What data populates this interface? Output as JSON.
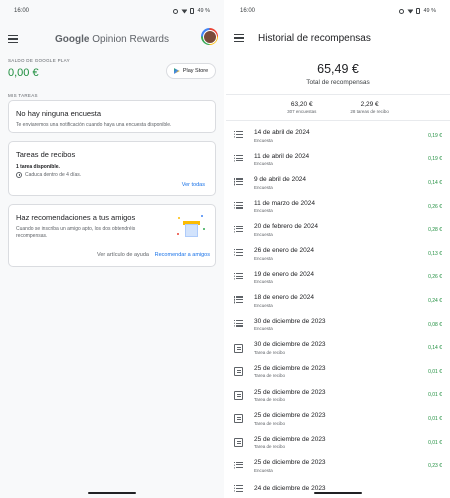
{
  "left": {
    "status": {
      "time": "16:00",
      "battery": "49 %"
    },
    "brand": {
      "google": "Google",
      "rest": "Opinion Rewards"
    },
    "balance_label": "SALDO DE GOOGLE PLAY",
    "balance_value": "0,00 €",
    "play_store_button": "Play Store",
    "tasks_label": "MIS TAREAS",
    "survey_card": {
      "title": "No hay ninguna encuesta",
      "text": "Te enviaremos una notificación cuando haya una encuesta disponible."
    },
    "receipts_card": {
      "title": "Tareas de recibos",
      "available": "1 tarea disponible.",
      "expires": "Caduca dentro de 4 días.",
      "link": "Ver todas"
    },
    "recommend_card": {
      "title": "Haz recomendaciones a tus amigos",
      "text": "Cuando se inscriba un amigo apto, los dos obtendréis recompensas.",
      "help_link": "Ver artículo de ayuda",
      "action_link": "Recomendar a amigos"
    }
  },
  "right": {
    "status": {
      "time": "16:00",
      "battery": "49 %"
    },
    "title": "Historial de recompensas",
    "total_value": "65,49 €",
    "total_label": "Total de recompensas",
    "stats": [
      {
        "value": "63,20 €",
        "label": "307 encuestas"
      },
      {
        "value": "2,29 €",
        "label": "28 tareas de recibo"
      }
    ],
    "entries": [
      {
        "date": "14 de abril de 2024",
        "type": "Encuesta",
        "amount": "0,19 €",
        "icon": "list-icon"
      },
      {
        "date": "11 de abril de 2024",
        "type": "Encuesta",
        "amount": "0,19 €",
        "icon": "list-icon"
      },
      {
        "date": "9 de abril de 2024",
        "type": "Encuesta",
        "amount": "0,14 €",
        "icon": "list-icon"
      },
      {
        "date": "11 de marzo de 2024",
        "type": "Encuesta",
        "amount": "0,26 €",
        "icon": "list-icon"
      },
      {
        "date": "20 de febrero de 2024",
        "type": "Encuesta",
        "amount": "0,28 €",
        "icon": "list-icon"
      },
      {
        "date": "26 de enero de 2024",
        "type": "Encuesta",
        "amount": "0,13 €",
        "icon": "list-icon"
      },
      {
        "date": "19 de enero de 2024",
        "type": "Encuesta",
        "amount": "0,26 €",
        "icon": "list-icon"
      },
      {
        "date": "18 de enero de 2024",
        "type": "Encuesta",
        "amount": "0,24 €",
        "icon": "list-icon"
      },
      {
        "date": "30 de diciembre de 2023",
        "type": "Encuesta",
        "amount": "0,08 €",
        "icon": "list-icon"
      },
      {
        "date": "30 de diciembre de 2023",
        "type": "Tarea de recibo",
        "amount": "0,14 €",
        "icon": "receipt-icon"
      },
      {
        "date": "25 de diciembre de 2023",
        "type": "Tarea de recibo",
        "amount": "0,01 €",
        "icon": "receipt-icon"
      },
      {
        "date": "25 de diciembre de 2023",
        "type": "Tarea de recibo",
        "amount": "0,01 €",
        "icon": "receipt-icon"
      },
      {
        "date": "25 de diciembre de 2023",
        "type": "Tarea de recibo",
        "amount": "0,01 €",
        "icon": "receipt-icon"
      },
      {
        "date": "25 de diciembre de 2023",
        "type": "Tarea de recibo",
        "amount": "0,01 €",
        "icon": "receipt-icon"
      },
      {
        "date": "25 de diciembre de 2023",
        "type": "Encuesta",
        "amount": "0,23 €",
        "icon": "list-icon"
      },
      {
        "date": "24 de diciembre de 2023",
        "type": "",
        "amount": "",
        "icon": "list-icon"
      }
    ]
  }
}
